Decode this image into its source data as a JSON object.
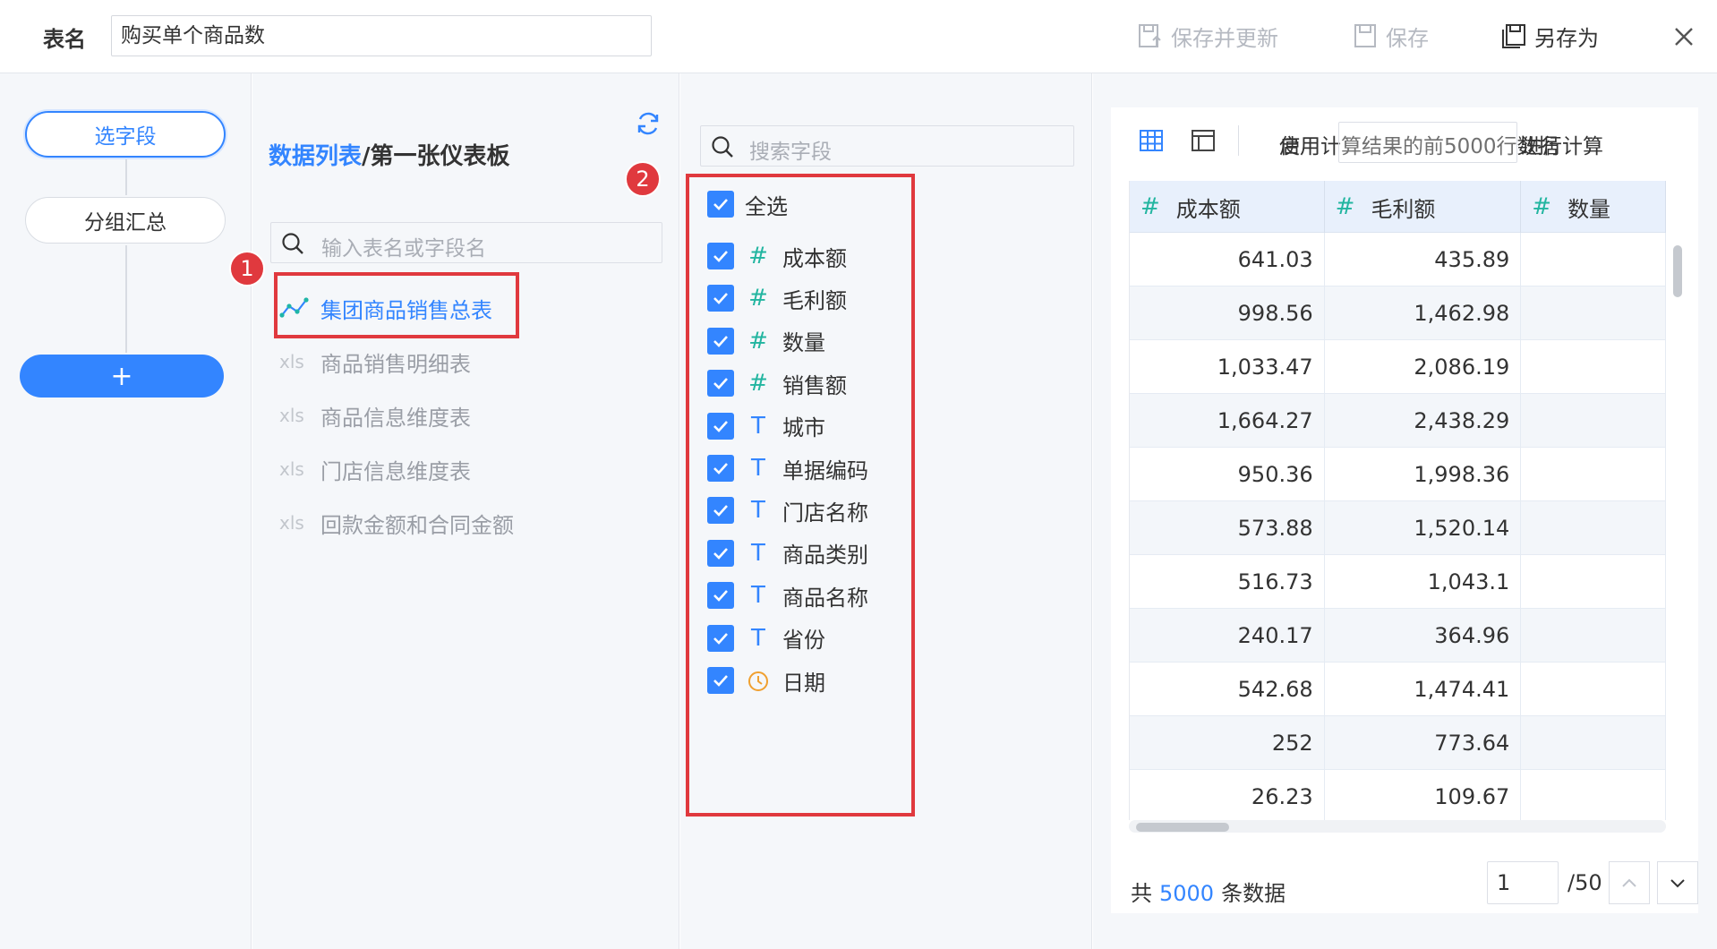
{
  "header": {
    "table_label": "表名",
    "table_name": "购买单个商品数",
    "save_update_label": "保存并更新",
    "save_label": "保存",
    "save_as_label": "另存为"
  },
  "steps": {
    "select_fields": "选字段",
    "group_summary": "分组汇总",
    "add": "+"
  },
  "table_list": {
    "breadcrumb_link": "数据列表",
    "breadcrumb_sep": "/",
    "breadcrumb_current": "第一张仪表板",
    "search_placeholder": "输入表名或字段名",
    "items": [
      {
        "label": "集团商品销售总表",
        "icon": "analysis-line-icon",
        "active": true
      },
      {
        "label": "商品销售明细表",
        "icon": "xls-icon",
        "active": false
      },
      {
        "label": "商品信息维度表",
        "icon": "xls-icon",
        "active": false
      },
      {
        "label": "门店信息维度表",
        "icon": "xls-icon",
        "active": false
      },
      {
        "label": "回款金额和合同金额",
        "icon": "xls-icon",
        "active": false
      }
    ],
    "badge": "1"
  },
  "fields": {
    "search_placeholder": "搜索字段",
    "select_all": "全选",
    "badge": "2",
    "type_symbols": {
      "number": "#",
      "text": "T"
    },
    "items": [
      {
        "label": "成本额",
        "type": "number",
        "checked": true
      },
      {
        "label": "毛利额",
        "type": "number",
        "checked": true
      },
      {
        "label": "数量",
        "type": "number",
        "checked": true
      },
      {
        "label": "销售额",
        "type": "number",
        "checked": true
      },
      {
        "label": "城市",
        "type": "text",
        "checked": true
      },
      {
        "label": "单据编码",
        "type": "text",
        "checked": true
      },
      {
        "label": "门店名称",
        "type": "text",
        "checked": true
      },
      {
        "label": "商品类别",
        "type": "text",
        "checked": true
      },
      {
        "label": "商品名称",
        "type": "text",
        "checked": true
      },
      {
        "label": "省份",
        "type": "text",
        "checked": true
      },
      {
        "label": "日期",
        "type": "date",
        "checked": true
      }
    ]
  },
  "preview": {
    "calc_text_a": "使用计算结果的前5000行数据",
    "calc_text_b": "启用",
    "calc_text_c": "进行计算",
    "hash": "#",
    "columns": [
      "成本额",
      "毛利额",
      "数量"
    ],
    "rows": [
      [
        "641.03",
        "435.89",
        ""
      ],
      [
        "998.56",
        "1,462.98",
        ""
      ],
      [
        "1,033.47",
        "2,086.19",
        ""
      ],
      [
        "1,664.27",
        "2,438.29",
        ""
      ],
      [
        "950.36",
        "1,998.36",
        ""
      ],
      [
        "573.88",
        "1,520.14",
        ""
      ],
      [
        "516.73",
        "1,043.1",
        ""
      ],
      [
        "240.17",
        "364.96",
        ""
      ],
      [
        "542.68",
        "1,474.41",
        ""
      ],
      [
        "252",
        "773.64",
        ""
      ],
      [
        "26.23",
        "109.67",
        ""
      ]
    ],
    "total_prefix": "共",
    "total_count": "5000",
    "total_suffix": "条数据",
    "page_current": "1",
    "page_total": "/50"
  },
  "colors": {
    "accent": "#3385ff",
    "annotation_red": "#e0393e",
    "number_type": "#22b5a0",
    "date_type": "#f0a030"
  }
}
